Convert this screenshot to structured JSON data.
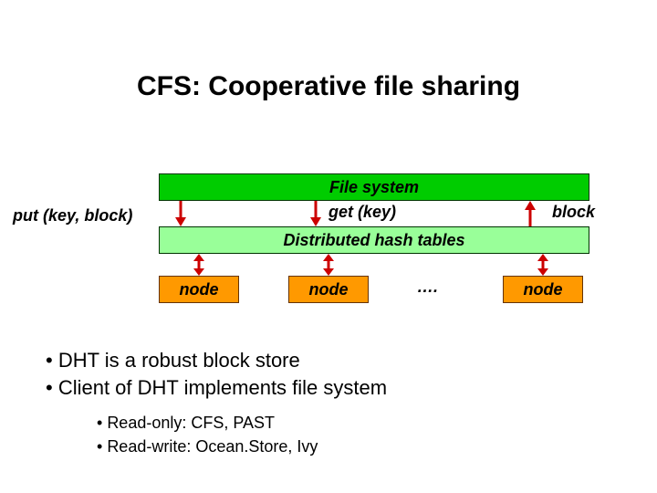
{
  "title": "CFS: Cooperative file sharing",
  "layers": {
    "fs": "File system",
    "dht": "Distributed hash tables"
  },
  "labels": {
    "put": "put (key, block)",
    "get": "get (key)",
    "block": "block"
  },
  "nodes": {
    "n1": "node",
    "n2": "node",
    "n3": "node",
    "dots": "…."
  },
  "bullets": {
    "b1": "DHT is a robust block store",
    "b2": "Client of DHT implements file system",
    "sb1": "Read-only: CFS, PAST",
    "sb2": "Read-write: Ocean.Store, Ivy"
  }
}
